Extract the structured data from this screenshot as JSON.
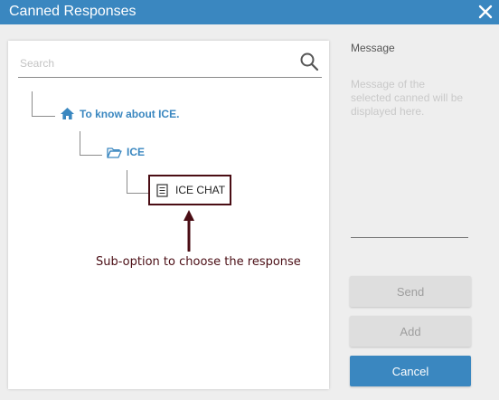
{
  "window": {
    "title": "Canned Responses"
  },
  "search": {
    "placeholder": "Search"
  },
  "tree": {
    "root": {
      "label": "To know about ICE."
    },
    "folder": {
      "label": "ICE"
    },
    "item": {
      "label": "ICE CHAT"
    }
  },
  "annotation": {
    "text": "Sub-option to choose the response"
  },
  "message": {
    "label": "Message",
    "placeholder": "Message of the selected canned will be displayed here."
  },
  "buttons": {
    "send": "Send",
    "add": "Add",
    "cancel": "Cancel"
  },
  "colors": {
    "accent": "#3a87c0",
    "annotation": "#4a0d14",
    "disabled": "#dedede"
  }
}
